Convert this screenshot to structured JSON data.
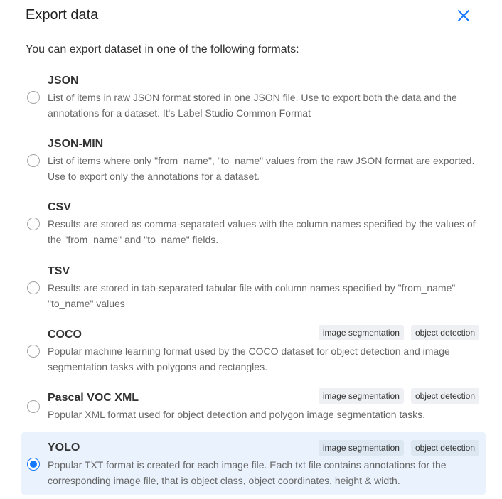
{
  "dialog": {
    "title": "Export data",
    "intro": "You can export dataset in one of the following formats:"
  },
  "formats": [
    {
      "name": "JSON",
      "description": "List of items in raw JSON format stored in one JSON file. Use to export both the data and the annotations for a dataset. It's Label Studio Common Format",
      "tags": [],
      "selected": false
    },
    {
      "name": "JSON-MIN",
      "description": "List of items where only \"from_name\", \"to_name\" values from the raw JSON format are exported. Use to export only the annotations for a dataset.",
      "tags": [],
      "selected": false
    },
    {
      "name": "CSV",
      "description": "Results are stored as comma-separated values with the column names specified by the values of the \"from_name\" and \"to_name\" fields.",
      "tags": [],
      "selected": false
    },
    {
      "name": "TSV",
      "description": "Results are stored in tab-separated tabular file with column names specified by \"from_name\" \"to_name\" values",
      "tags": [],
      "selected": false
    },
    {
      "name": "COCO",
      "description": "Popular machine learning format used by the COCO dataset for object detection and image segmentation tasks with polygons and rectangles.",
      "tags": [
        "image segmentation",
        "object detection"
      ],
      "selected": false
    },
    {
      "name": "Pascal VOC XML",
      "description": "Popular XML format used for object detection and polygon image segmentation tasks.",
      "tags": [
        "image segmentation",
        "object detection"
      ],
      "selected": false
    },
    {
      "name": "YOLO",
      "description": "Popular TXT format is created for each image file. Each txt file contains annotations for the corresponding image file, that is object class, object coordinates, height & width.",
      "tags": [
        "image segmentation",
        "object detection"
      ],
      "selected": true
    }
  ],
  "icons": {
    "close": "close-x-icon"
  },
  "colors": {
    "accent": "#1677ff",
    "selected_bg": "#eaf3fd"
  }
}
